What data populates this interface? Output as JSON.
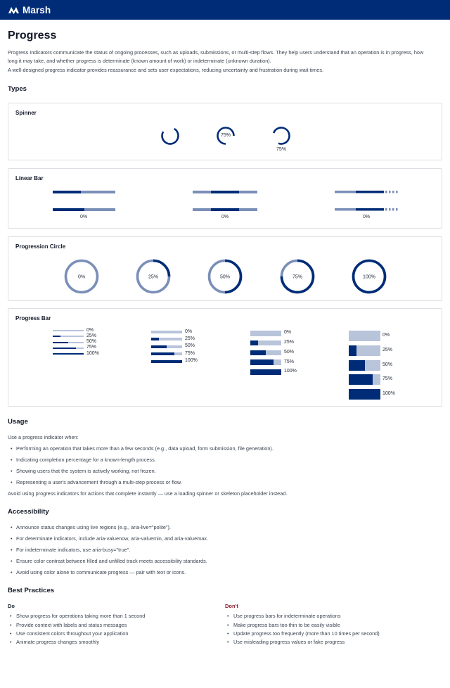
{
  "brand": {
    "name": "Marsh",
    "color": "#002c77"
  },
  "page": {
    "title": "Progress",
    "intro_line1": "Progress Indicators communicate the status of ongoing processes, such as uploads, submissions, or multi-step flows. They help users understand that an operation is in progress, how",
    "intro_line2": "long it may take, and whether progress is determinate (known amount of work) or indeterminate (unknown duration).",
    "intro2": "A well-designed progress indicator provides reassurance and sets user expectations, reducing uncertainty and frustration during wait times."
  },
  "types": {
    "heading": "Types",
    "spinner": {
      "title": "Spinner",
      "inner_label": "75%",
      "below_label": "75%"
    },
    "linear": {
      "title": "Linear Bar",
      "labels": [
        "0%",
        "0%",
        "0%"
      ]
    },
    "circle": {
      "title": "Progression Circle",
      "labels": [
        "0%",
        "25%",
        "50%",
        "75%",
        "100%"
      ],
      "values": [
        0,
        25,
        50,
        75,
        100
      ]
    },
    "bar": {
      "title": "Progress Bar",
      "labels": [
        "0%",
        "25%",
        "50%",
        "75%",
        "100%"
      ],
      "values": [
        0,
        25,
        50,
        75,
        100
      ]
    }
  },
  "usage": {
    "heading": "Usage",
    "lead": "Use a progress indicator when:",
    "items": [
      "Performing an operation that takes more than a few seconds (e.g., data upload, form submission, file generation).",
      "Indicating completion percentage for a known-length process.",
      "Showing users that the system is actively working, not frozen.",
      "Representing a user's advancement through a multi-step process or flow."
    ],
    "avoid": "Avoid using progress indicators for actions that complete instantly — use a loading spinner or skeleton placeholder instead."
  },
  "accessibility": {
    "heading": "Accessibility",
    "items": [
      "Announce status changes using live regions (e.g., aria-live=\"polite\").",
      "For determinate indicators, include aria-valuenow, aria-valuemin, and aria-valuemax.",
      "For indeterminate indicators, use aria-busy=\"true\".",
      "Ensure color contrast between filled and unfilled track meets accessibility standards.",
      "Avoid using color alone to communicate progress — pair with text or icons."
    ]
  },
  "best": {
    "heading": "Best Practices",
    "do_label": "Do",
    "dont_label": "Don't",
    "do_color": "#1f2733",
    "dont_color": "#8a1c2b",
    "do": [
      "Show progress for operations taking more than 1 second",
      "Provide context with labels and status messages",
      "Use consistent colors throughout your application",
      "Animate progress changes smoothly"
    ],
    "dont": [
      "Use progress bars for indeterminate operations",
      "Make progress bars too thin to be easily visible",
      "Update progress too frequently (more than 10 times per second)",
      "Use misleading progress values or fake progress"
    ]
  }
}
